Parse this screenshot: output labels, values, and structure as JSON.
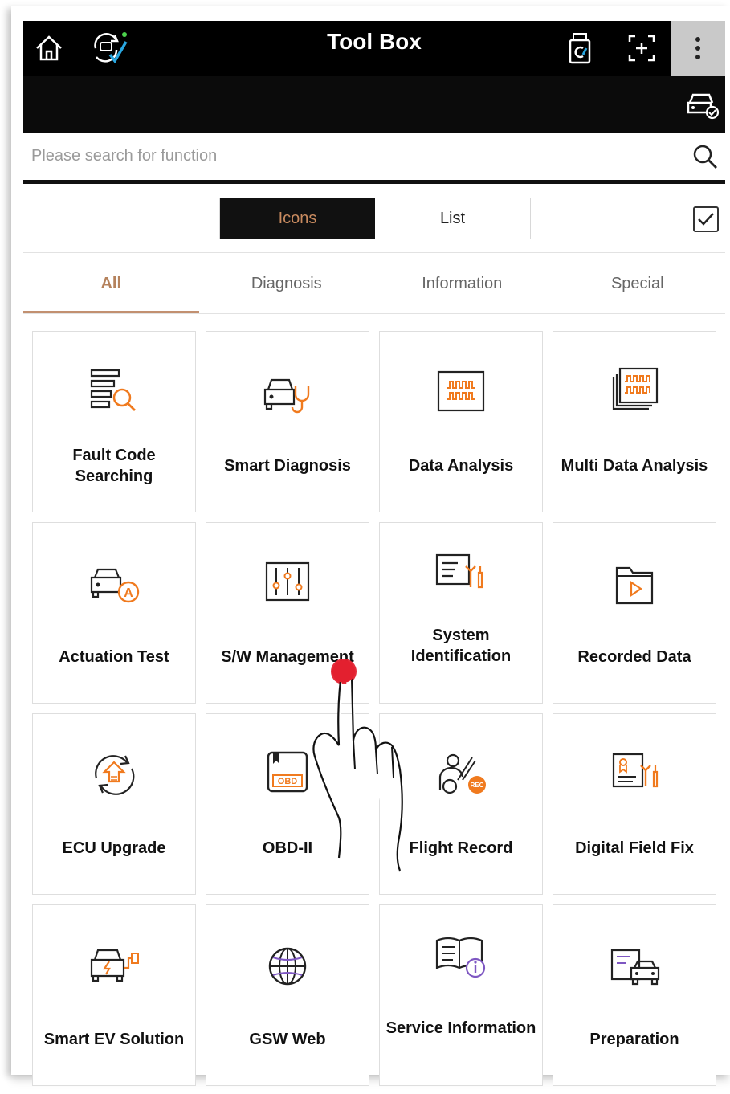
{
  "header": {
    "title": "Tool Box"
  },
  "search": {
    "placeholder": "Please search for function"
  },
  "view_toggle": {
    "icons_label": "Icons",
    "list_label": "List",
    "selected": "Icons"
  },
  "tabs": [
    {
      "label": "All",
      "active": true
    },
    {
      "label": "Diagnosis",
      "active": false
    },
    {
      "label": "Information",
      "active": false
    },
    {
      "label": "Special",
      "active": false
    }
  ],
  "tiles": [
    {
      "label": "Fault Code Searching",
      "icon": "fault-code-search-icon"
    },
    {
      "label": "Smart Diagnosis",
      "icon": "smart-diagnosis-icon"
    },
    {
      "label": "Data Analysis",
      "icon": "data-analysis-icon"
    },
    {
      "label": "Multi Data Analysis",
      "icon": "multi-data-analysis-icon"
    },
    {
      "label": "Actuation Test",
      "icon": "actuation-test-icon"
    },
    {
      "label": "S/W Management",
      "icon": "sw-management-icon"
    },
    {
      "label": "System Identification",
      "icon": "system-identification-icon"
    },
    {
      "label": "Recorded Data",
      "icon": "recorded-data-icon"
    },
    {
      "label": "ECU Upgrade",
      "icon": "ecu-upgrade-icon"
    },
    {
      "label": "OBD-II",
      "icon": "obd-icon"
    },
    {
      "label": "Flight Record",
      "icon": "flight-record-icon"
    },
    {
      "label": "Digital Field Fix",
      "icon": "digital-field-fix-icon"
    },
    {
      "label": "Smart EV Solution",
      "icon": "smart-ev-icon"
    },
    {
      "label": "GSW Web",
      "icon": "globe-icon"
    },
    {
      "label": "Service Information",
      "icon": "service-information-icon"
    },
    {
      "label": "Preparation",
      "icon": "preparation-icon"
    }
  ],
  "icon_text": {
    "obd": "OBD",
    "rec": "REC",
    "auto": "A"
  },
  "colors": {
    "accent": "#f07a1e",
    "active_tab": "#b5825c",
    "topbar": "#000000"
  }
}
